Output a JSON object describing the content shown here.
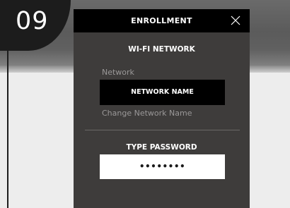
{
  "step": {
    "number": "09"
  },
  "modal": {
    "title": "ENROLLMENT",
    "close_icon": "close-icon",
    "wifi_section_title": "WI-FI NETWORK",
    "network_label": "Network",
    "network_name": "NETWORK NAME",
    "change_network_link": "Change Network Name",
    "password_section_title": "TYPE PASSWORD",
    "password_value": "••••••••"
  },
  "colors": {
    "modal_background": "#3e3c3b",
    "header_background": "#000000",
    "page_background": "#ededed",
    "top_band": "#5b5b5b"
  }
}
